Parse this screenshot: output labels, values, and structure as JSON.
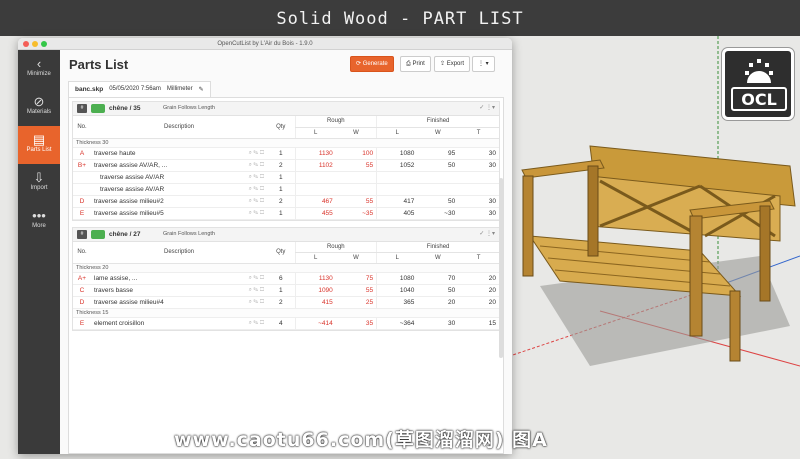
{
  "banner": {
    "title": "Solid Wood - PART LIST"
  },
  "logo": {
    "text": "OCL"
  },
  "window": {
    "title": "OpenCutList by L'Air du Bois - 1.9.0"
  },
  "sidebar": {
    "items": [
      {
        "label": "Minimize",
        "icon": "chevron-left-icon"
      },
      {
        "label": "Materials",
        "icon": "materials-icon"
      },
      {
        "label": "Parts List",
        "icon": "parts-list-icon"
      },
      {
        "label": "Import",
        "icon": "import-icon"
      },
      {
        "label": "More",
        "icon": "more-icon"
      }
    ]
  },
  "header": {
    "title": "Parts List",
    "generate_label": "Generate",
    "print_label": "Print",
    "export_label": "Export",
    "menu_label": "⋮ ▾"
  },
  "file": {
    "name": "banc.skp",
    "date": "05/05/2020 7:56am",
    "unit": "Millimeter"
  },
  "columns": {
    "no": "No.",
    "description": "Description",
    "qty": "Qty",
    "rough": "Rough",
    "finished": "Finished",
    "l": "L",
    "w": "W",
    "t": "T"
  },
  "groups": [
    {
      "number": "#",
      "material": "chêne / 35",
      "grain": "Grain Follows Length",
      "rows": [
        {
          "type": "thickness",
          "label": "Thickness 30"
        },
        {
          "no": "A",
          "desc": "traverse haute",
          "qty": "1",
          "rl": "1130",
          "rw": "100",
          "fl": "1080",
          "fw": "95",
          "ft": "30"
        },
        {
          "no": "B+",
          "desc": "traverse assise AV/AR, ...",
          "qty": "2",
          "rl": "1102",
          "rw": "55",
          "fl": "1052",
          "fw": "50",
          "ft": "30"
        },
        {
          "no": "",
          "desc": "traverse assise AV/AR",
          "qty": "1",
          "rl": "",
          "rw": "",
          "fl": "",
          "fw": "",
          "ft": "",
          "sub": true
        },
        {
          "no": "",
          "desc": "traverse assise AV/AR",
          "qty": "1",
          "rl": "",
          "rw": "",
          "fl": "",
          "fw": "",
          "ft": "",
          "sub": true
        },
        {
          "no": "D",
          "desc": "traverse assise milieu#2",
          "qty": "2",
          "rl": "467",
          "rw": "55",
          "fl": "417",
          "fw": "50",
          "ft": "30"
        },
        {
          "no": "E",
          "desc": "traverse assise milieu#5",
          "qty": "1",
          "rl": "455",
          "rw": "~35",
          "fl": "405",
          "fw": "~30",
          "ft": "30"
        }
      ]
    },
    {
      "number": "#",
      "material": "chêne / 27",
      "grain": "Grain Follows Length",
      "rows": [
        {
          "type": "thickness",
          "label": "Thickness 20"
        },
        {
          "no": "A+",
          "desc": "lame assise, ...",
          "qty": "6",
          "rl": "1130",
          "rw": "75",
          "fl": "1080",
          "fw": "70",
          "ft": "20"
        },
        {
          "no": "C",
          "desc": "travers basse",
          "qty": "1",
          "rl": "1090",
          "rw": "55",
          "fl": "1040",
          "fw": "50",
          "ft": "20"
        },
        {
          "no": "D",
          "desc": "traverse assise milieu#4",
          "qty": "2",
          "rl": "415",
          "rw": "25",
          "fl": "365",
          "fw": "20",
          "ft": "20"
        },
        {
          "type": "thickness",
          "label": "Thickness 15"
        },
        {
          "no": "E",
          "desc": "element croisillon",
          "qty": "4",
          "rl": "~414",
          "rw": "35",
          "fl": "~364",
          "fw": "30",
          "ft": "15"
        }
      ]
    }
  ],
  "watermark": {
    "text": "www.caotu66.com(草图溜溜网) 图A"
  },
  "colors": {
    "accent": "#e8642c",
    "sidebar": "#3a3a3a",
    "rough": "#d9342b",
    "material": "#4caf50"
  }
}
